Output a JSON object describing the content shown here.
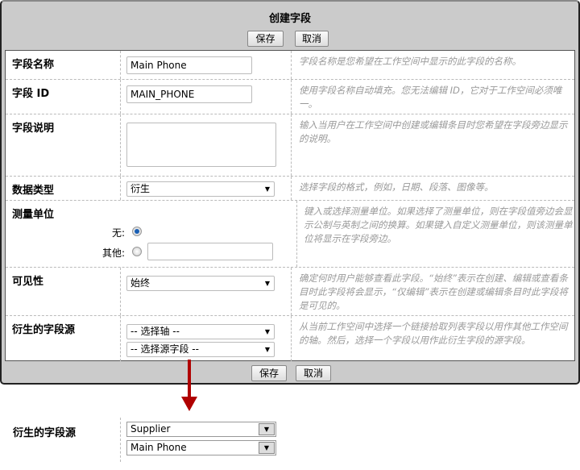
{
  "dialog": {
    "title": "创建字段",
    "save": "保存",
    "cancel": "取消"
  },
  "rows": {
    "name": {
      "label": "字段名称",
      "value": "Main Phone",
      "help": "字段名称是您希望在工作空间中显示的此字段的名称。"
    },
    "id": {
      "label": "字段 ID",
      "value": "MAIN_PHONE",
      "help": "使用字段名称自动填充。您无法编辑 ID，它对于工作空间必须唯一。"
    },
    "desc": {
      "label": "字段说明",
      "value": "",
      "help": "输入当用户在工作空间中创建或编辑条目时您希望在字段旁边显示的说明。"
    },
    "type": {
      "label": "数据类型",
      "value": "衍生",
      "help": "选择字段的格式，例如，日期、段落、图像等。"
    },
    "unit": {
      "label": "测量单位",
      "none": "无:",
      "other": "其他:",
      "other_value": "",
      "selected": "none",
      "help": "键入或选择测量单位。如果选择了测量单位，则在字段值旁边会显示公制与英制之间的换算。如果键入自定义测量单位，则该测量单位将显示在字段旁边。"
    },
    "visibility": {
      "label": "可见性",
      "value": "始终",
      "help": "确定何时用户能够查看此字段。“始终”表示在创建、编辑或查看条目时此字段将会显示，“仅编辑”表示在创建或编辑条目时此字段将是可见的。"
    },
    "source": {
      "label": "衍生的字段源",
      "axis": "-- 选择轴 --",
      "field": "-- 选择源字段 --",
      "help": "从当前工作空间中选择一个链接拾取列表字段以用作其他工作空间的轴。然后，选择一个字段以用作此衍生字段的源字段。"
    }
  },
  "example": {
    "label": "衍生的字段源",
    "axis": "Supplier",
    "field": "Main Phone"
  },
  "colors": {
    "arrow": "#b00000"
  }
}
